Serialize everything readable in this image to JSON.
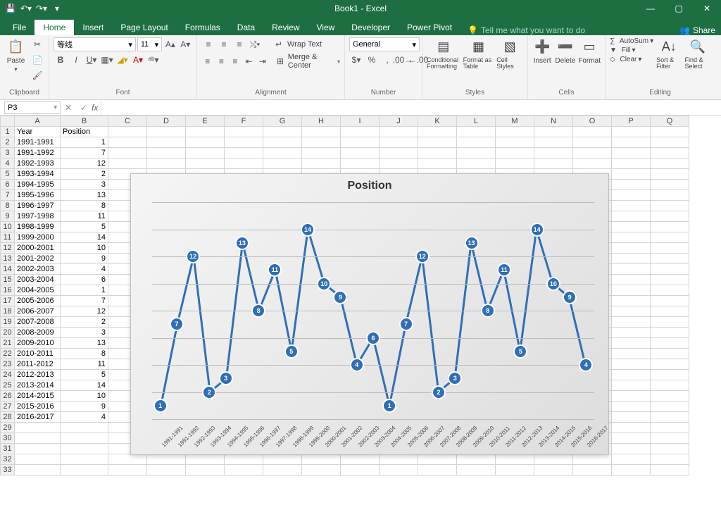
{
  "window": {
    "title": "Book1 - Excel"
  },
  "tabs": {
    "file": "File",
    "home": "Home",
    "insert": "Insert",
    "pageLayout": "Page Layout",
    "formulas": "Formulas",
    "data": "Data",
    "review": "Review",
    "view": "View",
    "developer": "Developer",
    "powerPivot": "Power Pivot",
    "tell": "Tell me what you want to do",
    "share": "Share"
  },
  "ribbon": {
    "clipboard": {
      "label": "Clipboard",
      "paste": "Paste"
    },
    "font": {
      "label": "Font",
      "family": "等线",
      "size": "11"
    },
    "alignment": {
      "label": "Alignment",
      "wrap": "Wrap Text",
      "merge": "Merge & Center"
    },
    "number": {
      "label": "Number",
      "format": "General"
    },
    "styles": {
      "label": "Styles",
      "cond": "Conditional Formatting",
      "table": "Format as Table",
      "cell": "Cell Styles"
    },
    "cells": {
      "label": "Cells",
      "insert": "Insert",
      "delete": "Delete",
      "format": "Format"
    },
    "editing": {
      "label": "Editing",
      "autosum": "AutoSum",
      "fill": "Fill",
      "clear": "Clear",
      "sort": "Sort & Filter",
      "find": "Find & Select"
    }
  },
  "formulaBar": {
    "nameBox": "P3"
  },
  "sheet": {
    "columns": [
      "",
      "A",
      "B",
      "C",
      "D",
      "E",
      "F",
      "G",
      "H",
      "I",
      "J",
      "K",
      "L",
      "M",
      "N",
      "O",
      "P",
      "Q"
    ],
    "headerRow": {
      "a": "Year",
      "b": "Position"
    },
    "rows": [
      {
        "n": 2,
        "a": "1991-1991",
        "b": 1
      },
      {
        "n": 3,
        "a": "1991-1992",
        "b": 7
      },
      {
        "n": 4,
        "a": "1992-1993",
        "b": 12
      },
      {
        "n": 5,
        "a": "1993-1994",
        "b": 2
      },
      {
        "n": 6,
        "a": "1994-1995",
        "b": 3
      },
      {
        "n": 7,
        "a": "1995-1996",
        "b": 13
      },
      {
        "n": 8,
        "a": "1996-1997",
        "b": 8
      },
      {
        "n": 9,
        "a": "1997-1998",
        "b": 11
      },
      {
        "n": 10,
        "a": "1998-1999",
        "b": 5
      },
      {
        "n": 11,
        "a": "1999-2000",
        "b": 14
      },
      {
        "n": 12,
        "a": "2000-2001",
        "b": 10
      },
      {
        "n": 13,
        "a": "2001-2002",
        "b": 9
      },
      {
        "n": 14,
        "a": "2002-2003",
        "b": 4
      },
      {
        "n": 15,
        "a": "2003-2004",
        "b": 6
      },
      {
        "n": 16,
        "a": "2004-2005",
        "b": 1
      },
      {
        "n": 17,
        "a": "2005-2006",
        "b": 7
      },
      {
        "n": 18,
        "a": "2006-2007",
        "b": 12
      },
      {
        "n": 19,
        "a": "2007-2008",
        "b": 2
      },
      {
        "n": 20,
        "a": "2008-2009",
        "b": 3
      },
      {
        "n": 21,
        "a": "2009-2010",
        "b": 13
      },
      {
        "n": 22,
        "a": "2010-2011",
        "b": 8
      },
      {
        "n": 23,
        "a": "2011-2012",
        "b": 11
      },
      {
        "n": 24,
        "a": "2012-2013",
        "b": 5
      },
      {
        "n": 25,
        "a": "2013-2014",
        "b": 14
      },
      {
        "n": 26,
        "a": "2014-2015",
        "b": 10
      },
      {
        "n": 27,
        "a": "2015-2016",
        "b": 9
      },
      {
        "n": 28,
        "a": "2016-2017",
        "b": 4
      }
    ],
    "extraRows": [
      29,
      30,
      31,
      32,
      33
    ]
  },
  "chart_data": {
    "type": "line",
    "title": "Position",
    "categories": [
      "1991-1991",
      "1991-1992",
      "1992-1993",
      "1993-1994",
      "1994-1995",
      "1995-1996",
      "1996-1997",
      "1997-1998",
      "1998-1999",
      "1999-2000",
      "2000-2001",
      "2001-2002",
      "2002-2003",
      "2003-2004",
      "2004-2005",
      "2005-2006",
      "2006-2007",
      "2007-2008",
      "2008-2009",
      "2009-2010",
      "2010-2011",
      "2011-2012",
      "2012-2013",
      "2013-2014",
      "2014-2015",
      "2015-2016",
      "2016-2017"
    ],
    "values": [
      1,
      7,
      12,
      2,
      3,
      13,
      8,
      11,
      5,
      14,
      10,
      9,
      4,
      6,
      1,
      7,
      12,
      2,
      3,
      13,
      8,
      11,
      5,
      14,
      10,
      9,
      4
    ],
    "ylim": [
      0,
      16
    ],
    "xlabel": "",
    "ylabel": "",
    "marker_color": "#2f6fb6"
  }
}
